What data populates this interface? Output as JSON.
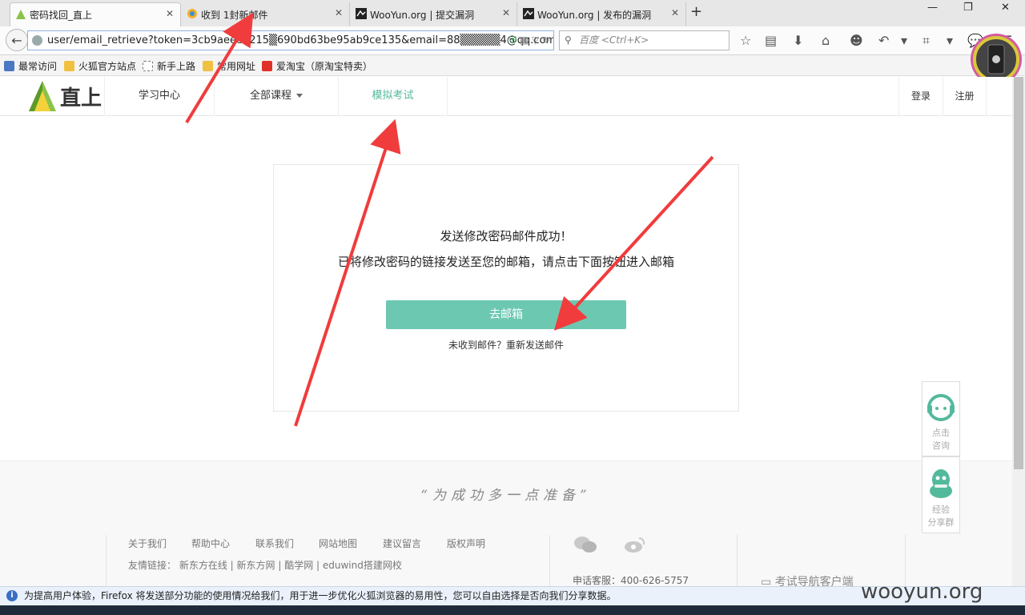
{
  "browser": {
    "tabs": [
      {
        "title": "密码找回_直上"
      },
      {
        "title": "收到 1封新邮件"
      },
      {
        "title": "WooYun.org | 提交漏洞"
      },
      {
        "title": "WooYun.org | 发布的漏洞"
      }
    ],
    "new_tab": "+",
    "url": "user/email_retrieve?token=3cb9aeee9215▒690bd63be95ab9ce135&email=88▒▒▒▒▒4@qq.com",
    "search_placeholder": "百度 <Ctrl+K>",
    "bookmarks": [
      {
        "label": "最常访问",
        "color": "#4a78c2"
      },
      {
        "label": "火狐官方站点",
        "color": "#f0c040"
      },
      {
        "label": "新手上路",
        "color": "#ffffff"
      },
      {
        "label": "常用网址",
        "color": "#f0c040"
      },
      {
        "label": "爱淘宝（原淘宝特卖）",
        "color": "#e0302a"
      }
    ],
    "notification": "为提高用户体验，Firefox 将发送部分功能的使用情况给我们，用于进一步优化火狐浏览器的易用性，您可以自由选择是否向我们分享数据。"
  },
  "site": {
    "logo_text": "直上",
    "nav": {
      "study": "学习中心",
      "courses": "全部课程",
      "exam": "模拟考试"
    },
    "login": "登录",
    "register": "注册",
    "accent": "#53b99c"
  },
  "card": {
    "title": "发送修改密码邮件成功！",
    "subtitle": "已将修改密码的链接发送至您的邮箱，请点击下面按钮进入邮箱",
    "button": "去邮箱",
    "resend": "未收到邮件？重新发送邮件"
  },
  "footer": {
    "slogan": "“为成功多一点准备”",
    "links": [
      "关于我们",
      "帮助中心",
      "联系我们",
      "网站地图",
      "建议留言",
      "版权声明"
    ],
    "friends_label": "友情链接：",
    "friends": "新东方在线 | 新东方网 | 酷学网 | eduwind搭建网校",
    "hotline": "申话客服：400-626-5757",
    "app": "考试导航客户端"
  },
  "side": {
    "consult": [
      "点击",
      "咨询"
    ],
    "group": [
      "经验",
      "分享群"
    ]
  },
  "watermark": "wooyun.org"
}
